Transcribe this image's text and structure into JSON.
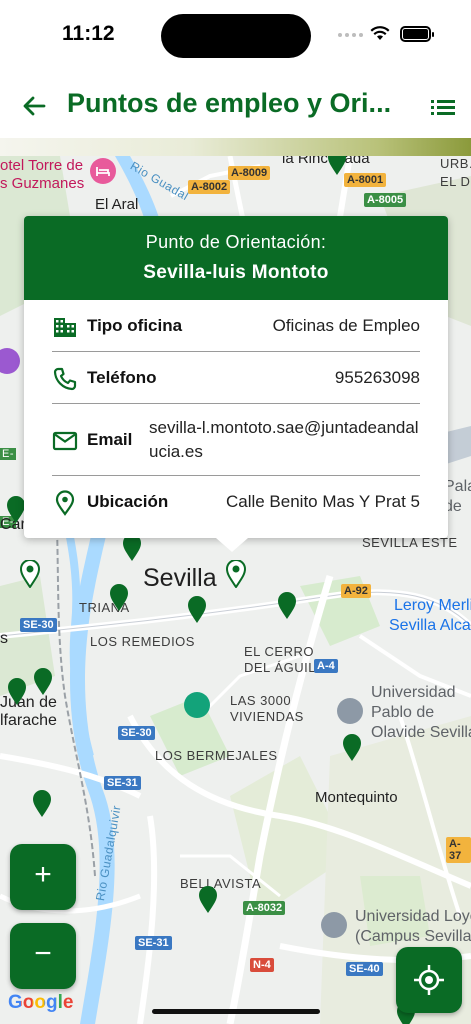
{
  "status_bar": {
    "time": "11:12"
  },
  "app_bar": {
    "title": "Puntos de empleo y Ori...",
    "icons": {
      "back": "arrow-back-icon",
      "list": "list-icon"
    },
    "accent_color": "#0a6b25"
  },
  "map": {
    "city_label": "Sevilla",
    "labels": {
      "hotel_line1": "otel Torre de",
      "hotel_line2": "s Guzmanes",
      "el_aral": "El Aral",
      "la_rinconada": "la Rinconada",
      "urb": "URB. R",
      "el_de": "EL DE",
      "triana": "TRIANA",
      "los_remedios": "LOS REMEDIOS",
      "el_cerro_line1": "EL CERRO",
      "el_cerro_line2": "DEL ÁGUILA",
      "las3000_line1": "LAS 3000",
      "las3000_line2": "VIVIENDAS",
      "los_bermejales": "LOS BERMEJALES",
      "montequinto": "Montequinto",
      "bellavista": "BELLAVISTA",
      "sevilla_este": "SEVILLA ESTE",
      "juan_line1": "Juan de",
      "juan_line2": "lfarache",
      "cam": "Cam",
      "s_left": "s",
      "pala_line1": "Pala",
      "pala_line2": "de",
      "leroy_line1": "Leroy Merli",
      "leroy_line2": "Sevilla Alca",
      "upo_line1": "Universidad",
      "upo_line2": "Pablo de",
      "upo_line3": "Olavide Sevilla",
      "uloyola_line1": "Universidad Loye",
      "uloyola_line2": "(Campus Sevilla",
      "rio_guadal": "Rio Guadal",
      "rio_guadalquivir": "Rio Guadalquivir"
    },
    "road_shields": {
      "a8009": "A-8009",
      "a8002": "A-8002",
      "a8001": "A-8001",
      "a8005": "A-8005",
      "a92": "A-92",
      "a4": "A-4",
      "se30_left": "SE-30",
      "se30_mid": "SE-30",
      "se31": "SE-31",
      "se31_bottom": "SE-31",
      "a8032": "A-8032",
      "n4": "N-4",
      "se40": "SE-40",
      "a37": "A-37",
      "e_left": "E-",
      "e_left2": "E-"
    },
    "attribution": "Google",
    "pin_color": "#0a6b25"
  },
  "info_card": {
    "subtitle": "Punto de Orientación:",
    "title": "Sevilla-luis Montoto",
    "rows": [
      {
        "icon": "building-icon",
        "label": "Tipo oficina",
        "value": "Oficinas de Empleo"
      },
      {
        "icon": "phone-icon",
        "label": "Teléfono",
        "value": "955263098"
      },
      {
        "icon": "email-icon",
        "label": "Email",
        "value": "sevilla-l.montoto.sae@juntadeandalucia.es"
      },
      {
        "icon": "location-pin-icon",
        "label": "Ubicación",
        "value": "Calle Benito Mas Y Prat 5"
      }
    ]
  },
  "controls": {
    "zoom_in": "+",
    "zoom_out": "−",
    "zoom_in_icon": "plus-icon",
    "zoom_out_icon": "minus-icon",
    "locate_icon": "my-location-icon"
  }
}
